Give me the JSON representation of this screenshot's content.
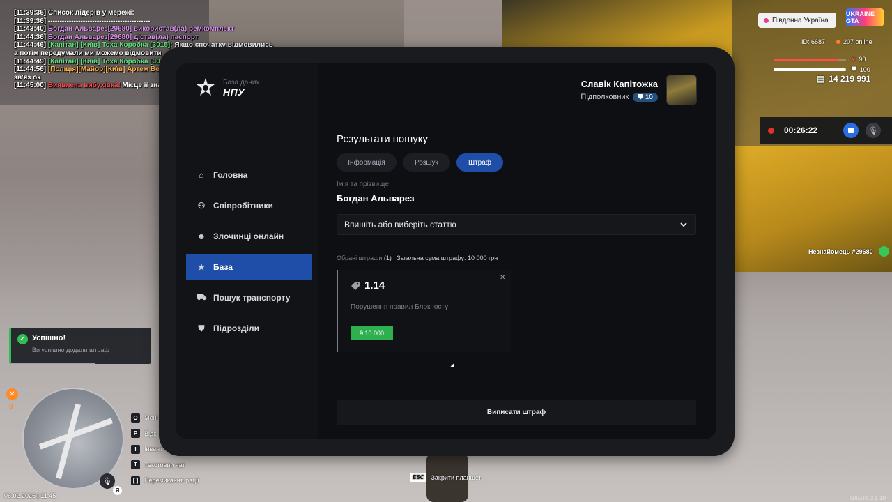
{
  "chat": [
    {
      "time": "[11:39:36]",
      "parts": [
        {
          "t": "Список лідерів у мережі:",
          "c": "white"
        }
      ]
    },
    {
      "time": "[11:39:36]",
      "parts": [
        {
          "t": "--------------------------------------------",
          "c": "white"
        }
      ]
    },
    {
      "time": "[11:43:40]",
      "parts": [
        {
          "t": "Богдан Альварез[29680] використав(ла) ремкомплект",
          "c": "purple"
        }
      ]
    },
    {
      "time": "[11:44:36]",
      "parts": [
        {
          "t": "Богдан Альварез[29680] дістав(ла) паспорт",
          "c": "purple"
        }
      ]
    },
    {
      "time": "[11:44:46]",
      "parts": [
        {
          "t": "[Капітан] [Київ]  Тоха Коробка [3015]:",
          "c": "green"
        },
        {
          "t": " Якщо спочатку відмовились а потім передумали ми можемо відмовити",
          "c": "white"
        }
      ]
    },
    {
      "time": "[11:44:49]",
      "parts": [
        {
          "t": "[Капітан] [Київ]  Тоха Коробка [3015]:",
          "c": "green"
        },
        {
          "t": " Верба",
          "c": "white"
        }
      ]
    },
    {
      "time": "[11:44:56]",
      "parts": [
        {
          "t": "[Поліція][Майор][Київ] Артем Верба [59730]:",
          "c": "orange"
        },
        {
          "t": " Держ-Адвокат на зв'яз ок",
          "c": "white"
        }
      ]
    },
    {
      "time": "[11:45:00]",
      "parts": [
        {
          "t": "Виявлена вибухівка!",
          "c": "red"
        },
        {
          "t": " Місце її знаходження відмічено на мапі.",
          "c": "white"
        }
      ]
    }
  ],
  "hud": {
    "server": "Південна Україна",
    "logo": "UKRAINE GTA",
    "id": "ID: 6687",
    "online": "207 online",
    "health": 90,
    "armor": 100,
    "money": "14 219 991",
    "rec_time": "00:26:22",
    "stranger": "Незнайомець #29680",
    "compass_value": "0",
    "mini_badge": "Я",
    "datetime": "06.02.2026 | 11:45",
    "watermark": "UAGTA 3.1 10",
    "esc_key": "ESC",
    "esc_label": "Закрити планшет",
    "keys": [
      {
        "k": "O",
        "label": "Мені"
      },
      {
        "k": "P",
        "label": "Відк"
      },
      {
        "k": "I",
        "label": "Інвент"
      },
      {
        "k": "T",
        "label": "Текстовий чат"
      },
      {
        "k": "[   ]",
        "label": "Перемикання рації"
      }
    ]
  },
  "toast": {
    "title": "Успішно!",
    "text": "Ви успішно додали штраф",
    "progress": 0.6
  },
  "tablet": {
    "logo_sub": "База даних",
    "logo_main": "НПУ",
    "nav": [
      {
        "label": "Головна",
        "icon": "home-icon",
        "active": false
      },
      {
        "label": "Співробітники",
        "icon": "people-icon",
        "active": false
      },
      {
        "label": "Злочинці онлайн",
        "icon": "mask-icon",
        "active": false
      },
      {
        "label": "База",
        "icon": "star-icon",
        "active": true
      },
      {
        "label": "Пошук транспорту",
        "icon": "car-icon",
        "active": false
      },
      {
        "label": "Підрозділи",
        "icon": "shield-icon",
        "active": false
      }
    ],
    "user": {
      "name": "Славік Капітожка",
      "rank": "Підполковник",
      "rank_level": "10"
    },
    "title": "Результати пошуку",
    "tabs": [
      {
        "label": "Інформація",
        "active": false
      },
      {
        "label": "Розшук",
        "active": false
      },
      {
        "label": "Штраф",
        "active": true
      }
    ],
    "field_label": "Ім'я та прізвище",
    "field_value": "Богдан Альварез",
    "select_placeholder": "Впишіть або виберіть статтю",
    "summary_muted": "Обрані штрафи",
    "summary_rest": " (1) | Загальна сума штрафу: 10 000 грн",
    "fine": {
      "code": "1.14",
      "description": "Порушення правил Блокпосту",
      "amount": "₴ 10 000"
    },
    "submit": "Виписати штраф"
  }
}
